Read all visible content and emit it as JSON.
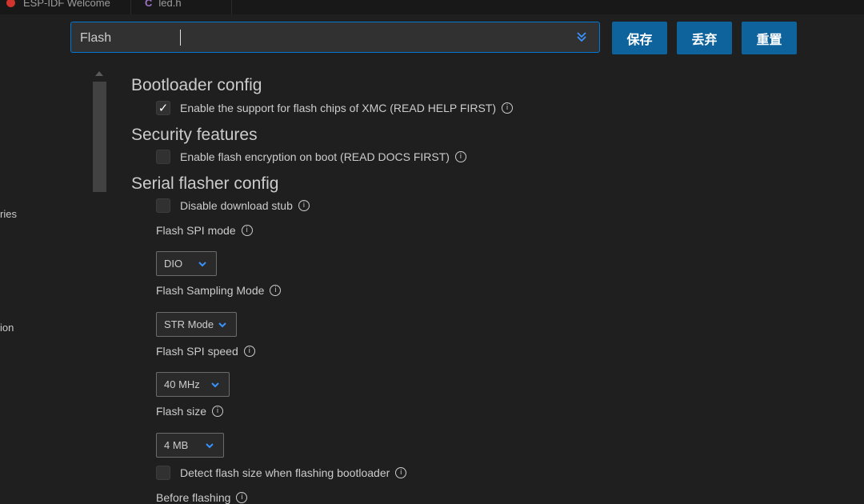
{
  "tabs": [
    {
      "label": "ESP-IDF Welcome",
      "icon": "esp-icon"
    },
    {
      "label": "led.h",
      "icon": "c-file-icon"
    }
  ],
  "search": {
    "value": "Flash",
    "placeholder": ""
  },
  "buttons": {
    "save": "保存",
    "discard": "丢弃",
    "reset": "重置"
  },
  "sidebar": {
    "items": [
      "ries",
      "ion"
    ]
  },
  "sections": [
    {
      "title": "Bootloader config"
    },
    {
      "title": "Security features"
    },
    {
      "title": "Serial flasher config"
    }
  ],
  "options": {
    "xmc": {
      "label": "Enable the support for flash chips of XMC (READ HELP FIRST)",
      "checked": true
    },
    "encryption": {
      "label": "Enable flash encryption on boot (READ DOCS FIRST)",
      "checked": false
    },
    "stub": {
      "label": "Disable download stub",
      "checked": false
    },
    "spi_mode": {
      "label": "Flash SPI mode",
      "value": "DIO"
    },
    "sampling": {
      "label": "Flash Sampling Mode",
      "value": "STR Mode"
    },
    "spi_speed": {
      "label": "Flash SPI speed",
      "value": "40 MHz"
    },
    "size": {
      "label": "Flash size",
      "value": "4 MB"
    },
    "detect": {
      "label": "Detect flash size when flashing bootloader",
      "checked": false
    },
    "before": {
      "label": "Before flashing"
    }
  },
  "checkmark": "✓",
  "info_glyph": "i",
  "colors": {
    "accent": "#0078d4",
    "button": "#0e639c",
    "background": "#1f1f1f",
    "chevron": "#3794ff"
  }
}
